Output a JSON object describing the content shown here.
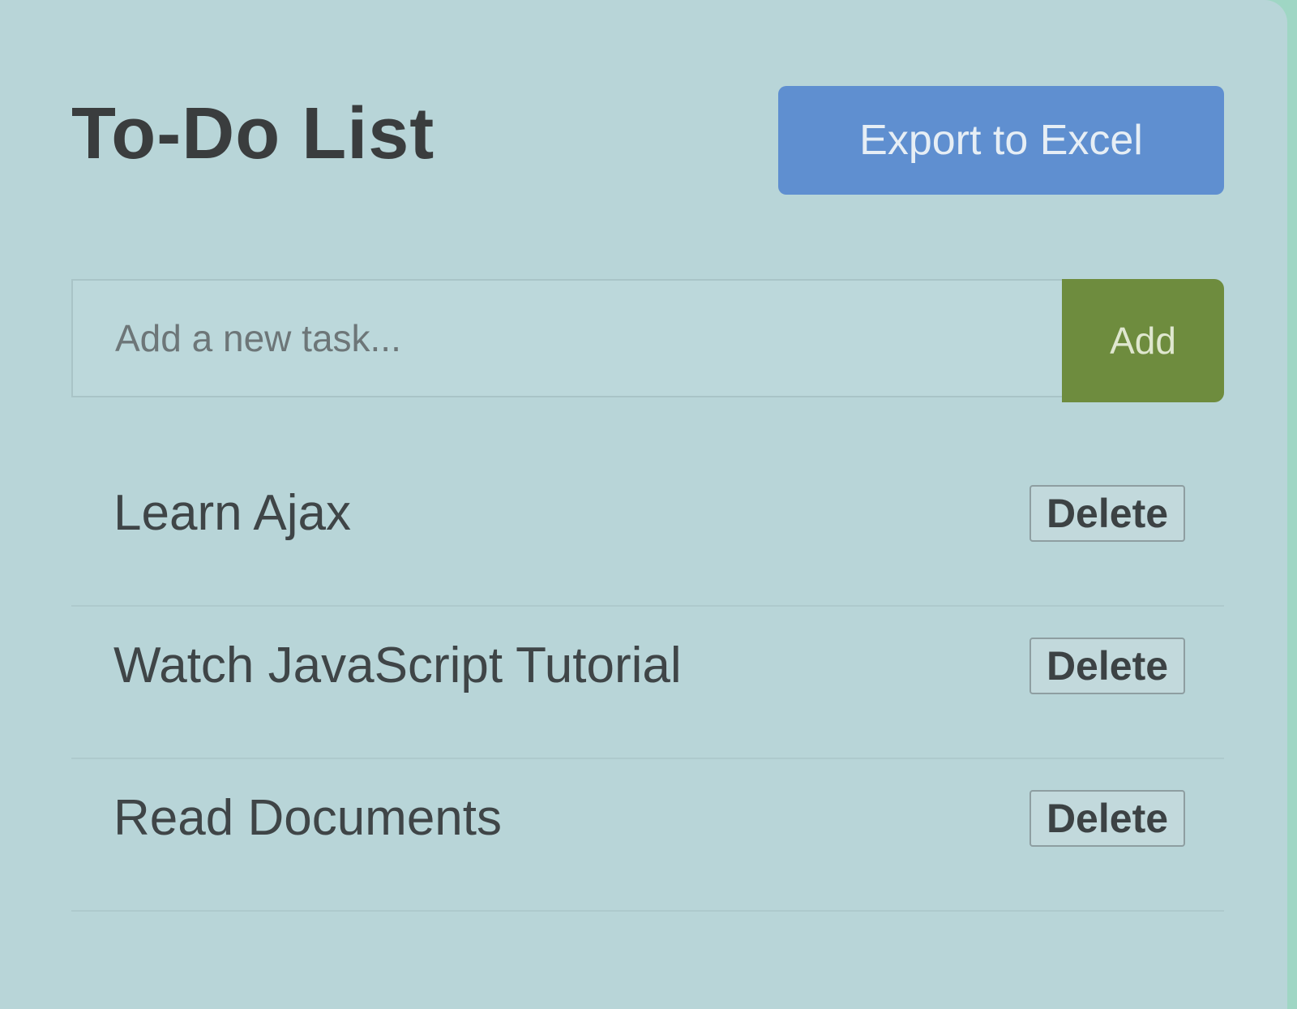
{
  "header": {
    "title": "To-Do List",
    "export_label": "Export to Excel"
  },
  "add_form": {
    "placeholder": "Add a new task...",
    "value": "",
    "add_label": "Add"
  },
  "tasks": [
    {
      "text": "Learn Ajax",
      "delete_label": "Delete"
    },
    {
      "text": "Watch JavaScript Tutorial",
      "delete_label": "Delete"
    },
    {
      "text": "Read Documents",
      "delete_label": "Delete"
    }
  ],
  "colors": {
    "export_button": "#5f8fd0",
    "add_button": "#6e8c3e",
    "card_background": "#b8d5d8"
  }
}
